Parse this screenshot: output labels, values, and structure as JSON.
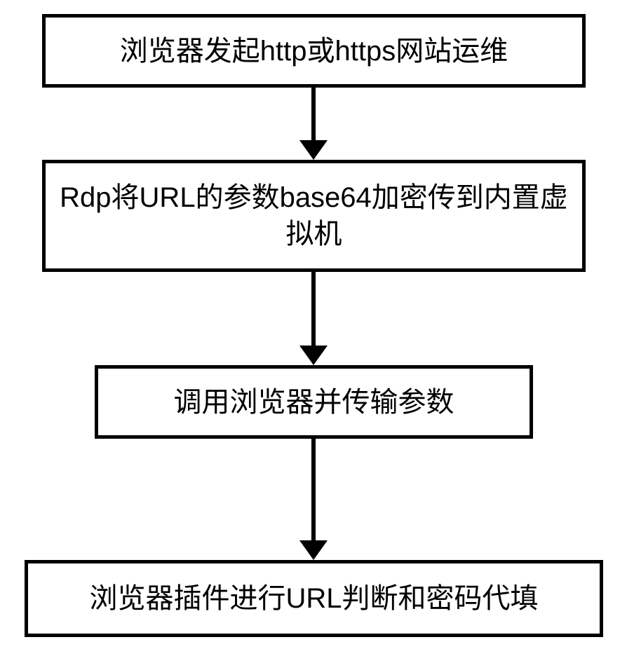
{
  "chart_data": {
    "type": "flowchart",
    "direction": "top-to-bottom",
    "nodes": [
      {
        "id": "n1",
        "text": "浏览器发起http或https网站运维"
      },
      {
        "id": "n2",
        "text": "Rdp将URL的参数base64加密传到内置虚拟机"
      },
      {
        "id": "n3",
        "text": "调用浏览器并传输参数"
      },
      {
        "id": "n4",
        "text": "浏览器插件进行URL判断和密码代填"
      }
    ],
    "edges": [
      {
        "from": "n1",
        "to": "n2"
      },
      {
        "from": "n2",
        "to": "n3"
      },
      {
        "from": "n3",
        "to": "n4"
      }
    ]
  }
}
